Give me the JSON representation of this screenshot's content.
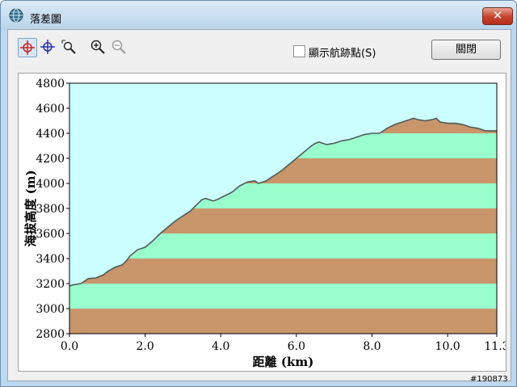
{
  "window": {
    "title": "落差圖",
    "close_glyph": "✕"
  },
  "toolbar": {
    "tools": [
      {
        "icon": "crosshair-red-icon",
        "active": true
      },
      {
        "icon": "crosshair-blue-icon",
        "active": false
      },
      {
        "icon": "zoom-box-icon",
        "active": false
      },
      {
        "icon": "zoom-in-icon",
        "active": false
      },
      {
        "icon": "zoom-out-icon",
        "active": false
      }
    ],
    "show_waypoints_label": "顯示航跡點(S)",
    "show_waypoints_checked": false,
    "close_button_label": "關閉"
  },
  "chart_data": {
    "type": "area",
    "xlabel": "距離  (km)",
    "ylabel": "海拔高度 (m)",
    "xlim": [
      0,
      11.3
    ],
    "ylim": [
      2800,
      4800
    ],
    "x_ticks": [
      "0.0",
      "2.0",
      "4.0",
      "6.0",
      "8.0",
      "10.0",
      "11.3"
    ],
    "x_tick_values": [
      0,
      2,
      4,
      6,
      8,
      10,
      11.3
    ],
    "y_ticks": [
      "2800",
      "3000",
      "3200",
      "3400",
      "3600",
      "3800",
      "4000",
      "4200",
      "4400",
      "4600",
      "4800"
    ],
    "y_tick_values": [
      2800,
      3000,
      3200,
      3400,
      3600,
      3800,
      4000,
      4200,
      4400,
      4600,
      4800
    ],
    "sky_color": "#ccffff",
    "band_colors": [
      "#c8966a",
      "#99ffcc"
    ],
    "line_color": "#4f5a5a",
    "series": [
      {
        "x": [
          0,
          0.1,
          0.3,
          0.5,
          0.7,
          0.9,
          1.0,
          1.2,
          1.4,
          1.5,
          1.6,
          1.8,
          2.0,
          2.2,
          2.4,
          2.6,
          2.8,
          3.0,
          3.2,
          3.4,
          3.5,
          3.6,
          3.8,
          3.9,
          4.1,
          4.3,
          4.5,
          4.7,
          4.9,
          5.0,
          5.2,
          5.4,
          5.6,
          5.8,
          6.0,
          6.2,
          6.4,
          6.5,
          6.6,
          6.8,
          7.0,
          7.2,
          7.4,
          7.6,
          7.8,
          8.0,
          8.2,
          8.4,
          8.6,
          8.8,
          9.0,
          9.1,
          9.2,
          9.4,
          9.6,
          9.7,
          9.8,
          10.0,
          10.2,
          10.4,
          10.6,
          10.8,
          11.0,
          11.1,
          11.3
        ],
        "y": [
          3180,
          3190,
          3200,
          3240,
          3245,
          3270,
          3295,
          3330,
          3350,
          3380,
          3420,
          3470,
          3490,
          3540,
          3600,
          3650,
          3700,
          3740,
          3780,
          3840,
          3870,
          3880,
          3860,
          3870,
          3900,
          3930,
          3980,
          4010,
          4020,
          4000,
          4020,
          4060,
          4100,
          4150,
          4200,
          4250,
          4300,
          4320,
          4330,
          4310,
          4320,
          4340,
          4350,
          4370,
          4390,
          4400,
          4400,
          4440,
          4470,
          4490,
          4510,
          4520,
          4510,
          4500,
          4510,
          4520,
          4490,
          4480,
          4480,
          4470,
          4450,
          4440,
          4420,
          4420,
          4420
        ]
      }
    ]
  },
  "watermark": "#190873"
}
